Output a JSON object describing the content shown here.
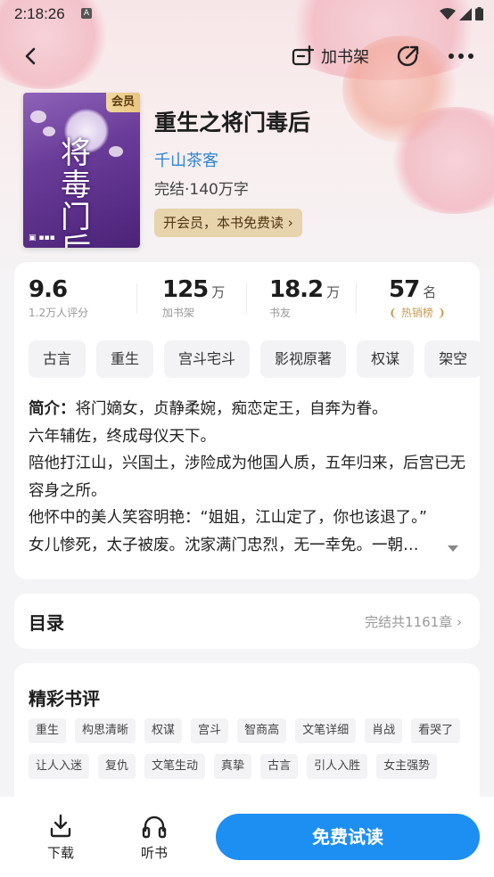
{
  "status_bar": {
    "time": "2:18:26",
    "badge": "A"
  },
  "toolbar": {
    "add_shelf_label": "加书架"
  },
  "book": {
    "title": "重生之将门毒后",
    "author": "千山茶客",
    "meta": "完结·140万字",
    "cover_badge": "会员",
    "cover_art_text": "将毒门后",
    "vip_prompt": "开会员，本书免费读 ›"
  },
  "stats": {
    "rating": {
      "value": "9.6",
      "label": "1.2万人评分"
    },
    "shelf": {
      "value": "125",
      "unit": "万",
      "label": "加书架"
    },
    "friends": {
      "value": "18.2",
      "unit": "万",
      "label": "书友"
    },
    "rank": {
      "value": "57",
      "unit": "名",
      "label": "热销榜"
    }
  },
  "genre_tags": [
    "古言",
    "重生",
    "宫斗宅斗",
    "影视原著",
    "权谋",
    "架空"
  ],
  "intro": {
    "label": "简介：",
    "lines": [
      "将门嫡女，贞静柔婉，痴恋定王，自奔为眷。",
      "六年辅佐，终成母仪天下。",
      "陪他打江山，兴国土，涉险成为他国人质，五年归来，后宫已无容身之所。",
      "他怀中的美人笑容明艳：“姐姐，江山定了，你也该退了。”",
      "女儿惨死，太子被废。沈家满门忠烈，无一幸免。一朝…"
    ]
  },
  "catalog": {
    "title": "目录",
    "summary": "完结共1161章 ›"
  },
  "reviews": {
    "title": "精彩书评",
    "tags": [
      "重生",
      "构思清晰",
      "权谋",
      "宫斗",
      "智商高",
      "文笔详细",
      "肖战",
      "看哭了",
      "让人入迷",
      "复仇",
      "文笔生动",
      "真挚",
      "古言",
      "引人入胜",
      "女主强势"
    ]
  },
  "bottom": {
    "download": "下载",
    "listen": "听书",
    "read_free": "免费试读"
  },
  "colors": {
    "accent": "#1e8ff2",
    "author": "#2f86d1",
    "vip_pill": "#e7d3ac",
    "rank_gold": "#c79d54"
  }
}
